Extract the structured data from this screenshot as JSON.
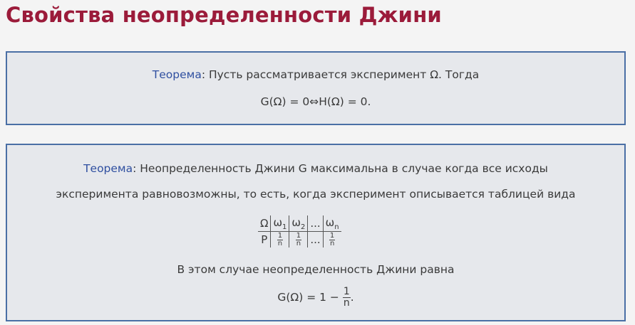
{
  "title": "Свойства неопределенности Джини",
  "theorem1": {
    "keyword": "Теорема",
    "text": ": Пусть рассматривается эксперимент Ω. Тогда",
    "formula": "G(Ω) = 0⇔H(Ω) = 0."
  },
  "theorem2": {
    "keyword": "Теорема",
    "text_line1": ": Неопределенность Джини G максимальна в случае когда все исходы",
    "text_line2": "эксперимента равновозможны, то есть, когда эксперимент описывается таблицей вида",
    "table": {
      "row_label_top": "Ω",
      "row_label_bottom": "P",
      "omega": "ω",
      "sub1": "1",
      "sub2": "2",
      "subn": "n",
      "ellipsis": "...",
      "frac_num": "1",
      "frac_den": "n"
    },
    "text_line4": "В этом случае неопределенность Джини равна",
    "formula_prefix": "G(Ω) = 1 −",
    "formula_num": "1",
    "formula_den": "n",
    "formula_suffix": "."
  }
}
